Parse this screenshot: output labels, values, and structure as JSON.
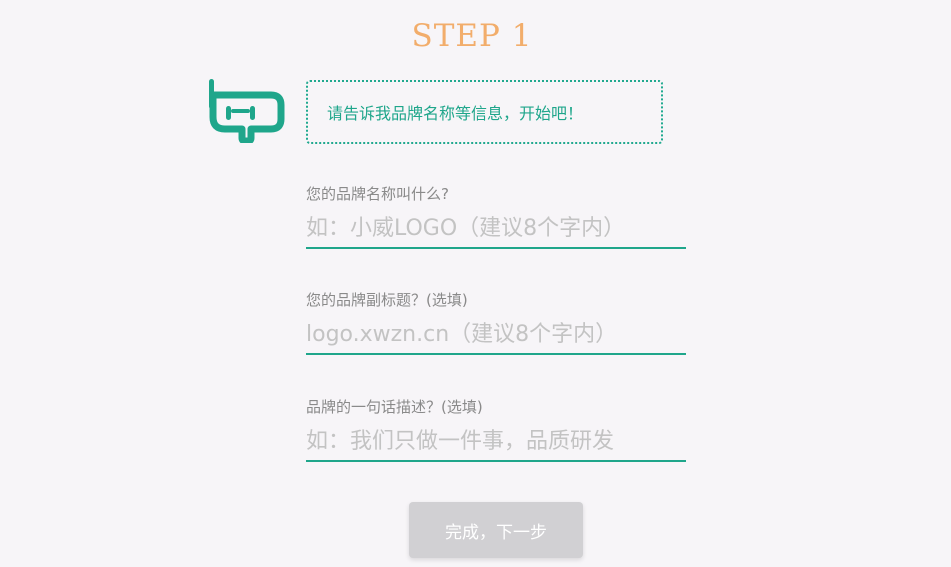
{
  "header": {
    "step_title": "STEP 1"
  },
  "bot": {
    "icon": "robot-logo-icon",
    "message": "请告诉我品牌名称等信息，开始吧！"
  },
  "form": {
    "brand_name": {
      "label": "您的品牌名称叫什么?",
      "placeholder": "如：小威LOGO（建议8个字内）",
      "value": ""
    },
    "brand_subtitle": {
      "label": "您的品牌副标题？(选填)",
      "placeholder": "logo.xwzn.cn（建议8个字内）",
      "value": ""
    },
    "brand_slogan": {
      "label": "品牌的一句话描述？(选填)",
      "placeholder": "如：我们只做一件事，品质研发",
      "value": ""
    },
    "submit_label": "完成，下一步"
  },
  "colors": {
    "accent": "#1fa68b",
    "step_title": "#f2ad6b",
    "background": "#f7f5f8",
    "button_disabled": "#d1d0d3"
  }
}
